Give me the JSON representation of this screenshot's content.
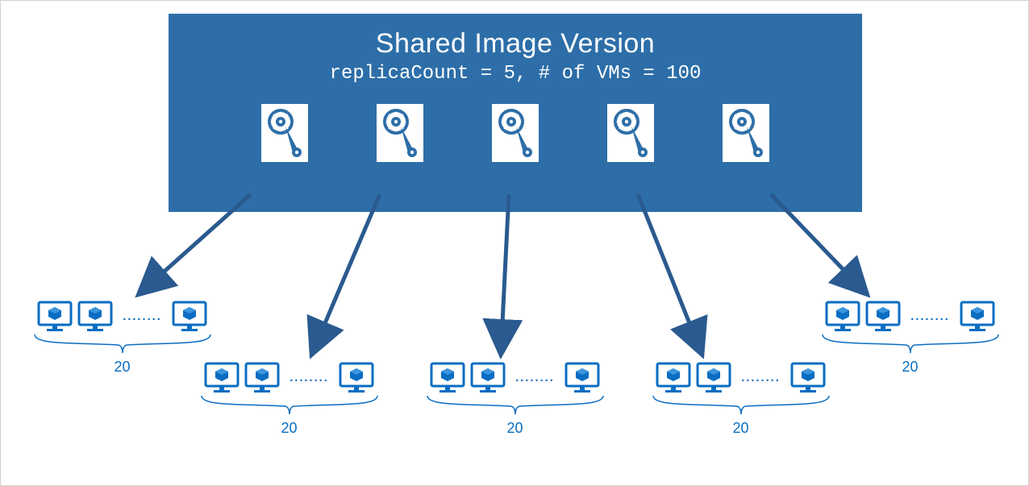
{
  "header": {
    "title": "Shared Image Version",
    "subtitle": "replicaCount = 5, # of VMs = 100"
  },
  "replicaCount": 5,
  "vmGroups": [
    {
      "count": "20"
    },
    {
      "count": "20"
    },
    {
      "count": "20"
    },
    {
      "count": "20"
    },
    {
      "count": "20"
    }
  ],
  "dotsText": "........",
  "colors": {
    "boxFill": "#2d6ea8",
    "accent": "#0a6dc2",
    "arrow": "#2a5a8f"
  }
}
